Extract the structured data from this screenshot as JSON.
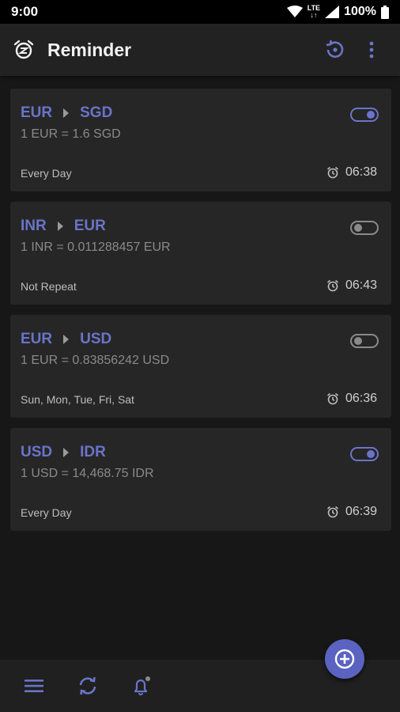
{
  "status_bar": {
    "time": "9:00",
    "network": "LTE",
    "battery": "100%"
  },
  "app_bar": {
    "title": "Reminder",
    "icons": [
      "alarm-clock-icon",
      "history-icon",
      "more-vert-icon"
    ]
  },
  "reminders": [
    {
      "from": "EUR",
      "to": "SGD",
      "rate": "1 EUR = 1.6 SGD",
      "repeat": "Every Day",
      "time": "06:38",
      "enabled": true
    },
    {
      "from": "INR",
      "to": "EUR",
      "rate": "1 INR = 0.011288457 EUR",
      "repeat": "Not Repeat",
      "time": "06:43",
      "enabled": false
    },
    {
      "from": "EUR",
      "to": "USD",
      "rate": "1 EUR = 0.83856242 USD",
      "repeat": "Sun, Mon, Tue, Fri, Sat",
      "time": "06:36",
      "enabled": false
    },
    {
      "from": "USD",
      "to": "IDR",
      "rate": "1 USD = 14,468.75 IDR",
      "repeat": "Every Day",
      "time": "06:39",
      "enabled": true
    }
  ],
  "bottom_nav": {
    "icons": [
      "menu-icon",
      "sync-icon",
      "bell-icon"
    ]
  },
  "fab": {
    "icon": "add-circle-icon"
  },
  "colors": {
    "accent": "#6a74c9",
    "background": "#171717",
    "card": "#262626",
    "appbar": "#222222"
  }
}
